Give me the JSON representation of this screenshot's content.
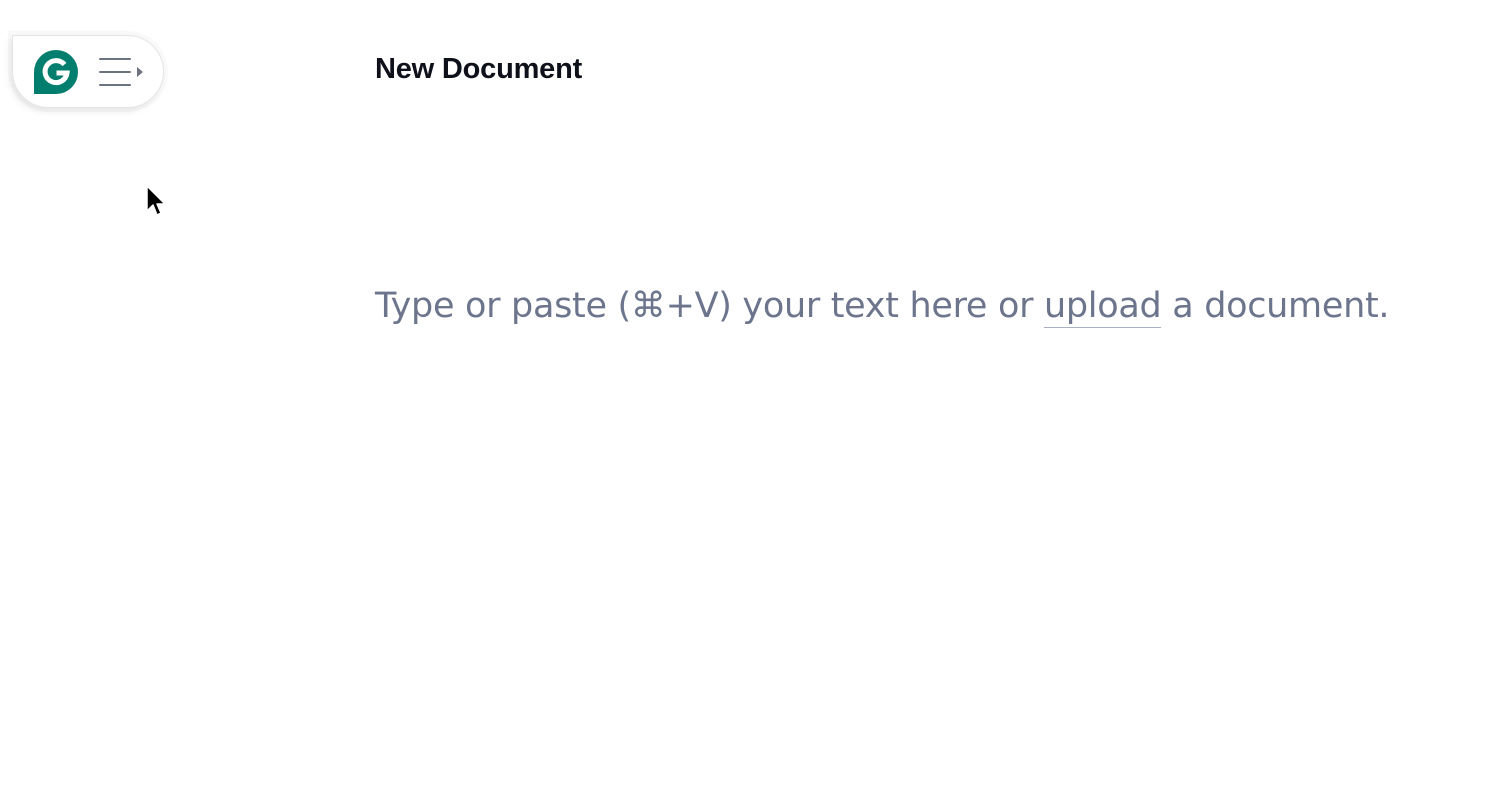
{
  "menu": {
    "logo_icon": "grammarly-g-icon",
    "logo_color": "#027e6f",
    "menu_icon": "hamburger-menu-icon",
    "expand_icon": "caret-right-icon"
  },
  "document": {
    "title": "New Document"
  },
  "editor": {
    "placeholder_before": "Type or paste (⌘+V) your text here or ",
    "upload_link": "upload",
    "placeholder_after": " a document."
  },
  "colors": {
    "accent": "#027e6f",
    "placeholder": "#6d758d",
    "title": "#0e101a"
  }
}
